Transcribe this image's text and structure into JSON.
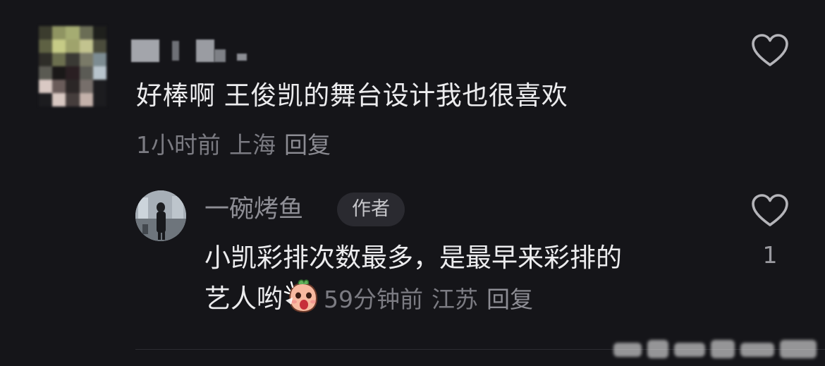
{
  "comment": {
    "text": "好棒啊 王俊凯的舞台设计我也很喜欢",
    "time": "1小时前",
    "location": "上海",
    "reply_label": "回复",
    "like_icon": "heart-outline-icon"
  },
  "reply": {
    "username": "一碗烤鱼",
    "badge": "作者",
    "text_line1": "小凯彩排次数最多，是最早来彩排的",
    "text_line2": "艺人哟",
    "emoji": "shocked-face-emoji-icon",
    "time": "59分钟前",
    "location": "江苏",
    "reply_label": "回复",
    "like_count": "1",
    "like_icon": "heart-outline-icon"
  },
  "colors": {
    "background": "#151519",
    "primary_text": "#ececee",
    "secondary_text": "#7b7b82",
    "badge_bg": "#2a2a30"
  }
}
